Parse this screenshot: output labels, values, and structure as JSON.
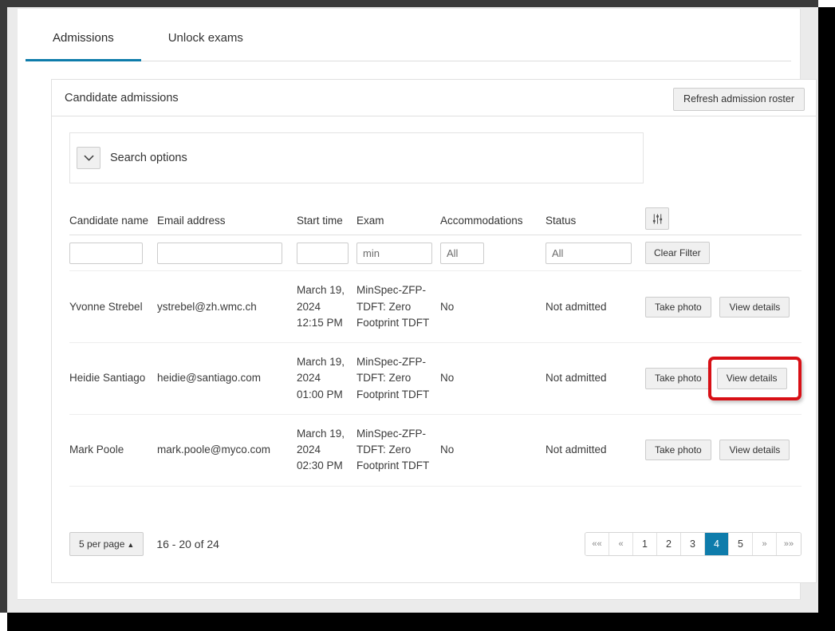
{
  "tabs": [
    {
      "label": "Admissions",
      "active": true
    },
    {
      "label": "Unlock exams",
      "active": false
    }
  ],
  "card": {
    "title": "Candidate admissions",
    "refresh_label": "Refresh admission roster"
  },
  "search": {
    "label": "Search options",
    "chevron_icon": "chevron-down-icon"
  },
  "table": {
    "columns": [
      "Candidate name",
      "Email address",
      "Start time",
      "Exam",
      "Accommodations",
      "Status"
    ],
    "tools_icon": "sliders-filter-icon",
    "filters": {
      "candidate_name": {
        "value": "",
        "placeholder": ""
      },
      "email_address": {
        "value": "",
        "placeholder": ""
      },
      "start_time": {
        "value": "",
        "placeholder": ""
      },
      "exam": {
        "value": "",
        "placeholder": "min"
      },
      "accommodations": {
        "value": "",
        "placeholder": "All"
      },
      "status": {
        "value": "",
        "placeholder": "All"
      },
      "clear_label": "Clear Filter"
    },
    "rows": [
      {
        "name": "Yvonne Strebel",
        "email": "ystrebel@zh.wmc.ch",
        "start_time": "March 19, 2024 12:15 PM",
        "exam": "MinSpec-ZFP-TDFT: Zero Footprint TDFT",
        "accommodations": "No",
        "status": "Not admitted",
        "take_photo_label": "Take photo",
        "view_details_label": "View details",
        "highlighted": false
      },
      {
        "name": "Heidie Santiago",
        "email": "heidie@santiago.com",
        "start_time": "March 19, 2024 01:00 PM",
        "exam": "MinSpec-ZFP-TDFT: Zero Footprint TDFT",
        "accommodations": "No",
        "status": "Not admitted",
        "take_photo_label": "Take photo",
        "view_details_label": "View details",
        "highlighted": true
      },
      {
        "name": "Mark Poole",
        "email": "mark.poole@myco.com",
        "start_time": "March 19, 2024 02:30 PM",
        "exam": "MinSpec-ZFP-TDFT: Zero Footprint TDFT",
        "accommodations": "No",
        "status": "Not admitted",
        "take_photo_label": "Take photo",
        "view_details_label": "View details",
        "highlighted": false
      }
    ]
  },
  "footer": {
    "per_page_label": "5 per page",
    "range_text": "16 - 20 of 24",
    "pages": [
      {
        "label": "««",
        "type": "arrow",
        "active": false
      },
      {
        "label": "«",
        "type": "arrow",
        "active": false
      },
      {
        "label": "1",
        "type": "num",
        "active": false
      },
      {
        "label": "2",
        "type": "num",
        "active": false
      },
      {
        "label": "3",
        "type": "num",
        "active": false
      },
      {
        "label": "4",
        "type": "num",
        "active": true
      },
      {
        "label": "5",
        "type": "num",
        "active": false
      },
      {
        "label": "»",
        "type": "arrow",
        "active": false
      },
      {
        "label": "»»",
        "type": "arrow",
        "active": false
      }
    ]
  },
  "colors": {
    "accent": "#0e7cab",
    "highlight": "#d81016",
    "text": "#333333",
    "border": "#e0e0e0",
    "button_bg": "#f0f0f0"
  }
}
